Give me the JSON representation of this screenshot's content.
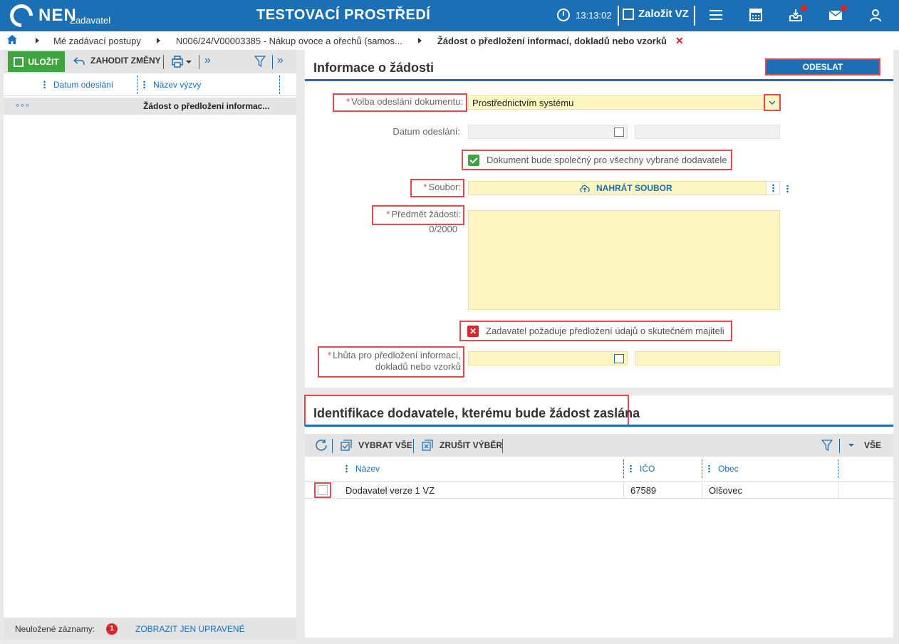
{
  "header": {
    "brand": "NEN",
    "brand_sub": "Zadavatel",
    "environment": "TESTOVACÍ PROSTŘEDÍ",
    "time": "13:13:02",
    "create_label": "Založit VZ",
    "icons": [
      "menu-icon",
      "calculator-icon",
      "inbox-icon",
      "mail-icon",
      "user-icon"
    ]
  },
  "breadcrumb": {
    "items": [
      "Mé zadávací postupy",
      "N006/24/V00003385 - Nákup ovoce a ořechů (samos...",
      "Žádost o předložení informací, dokladů nebo vzorků"
    ],
    "close": "✕"
  },
  "left_panel": {
    "save_label": "ULOŽIT",
    "discard_label": "ZAHODIT ZMĚNY",
    "columns": [
      "Datum odeslání",
      "Název výzvy"
    ],
    "rows": [
      {
        "menu": "∘∘∘",
        "date": "",
        "name": "Žádost o předložení informac..."
      }
    ],
    "footer_label": "Neuložené záznamy:",
    "footer_count": "1",
    "footer_link": "ZOBRAZIT JEN UPRAVENÉ"
  },
  "info_card": {
    "title": "Informace o žádosti",
    "send_label": "ODESLAT",
    "fields": {
      "volba_label": "Volba odeslání dokumentu:",
      "volba_value": "Prostřednictvím systému",
      "datum_label": "Datum odeslání:",
      "common_doc_label": "Dokument bude společný pro všechny vybrané dodavatele",
      "soubor_label": "Soubor:",
      "upload_label": "NAHRÁT SOUBOR",
      "predmet_label": "Předmět žádosti:",
      "predmet_counter": "0/2000",
      "majitel_label": "Zadavatel požaduje předložení údajů o skutečném majiteli",
      "lhuta_label_1": "Lhůta pro předložení informací,",
      "lhuta_label_2": "dokladů nebo vzorků"
    },
    "required_mark": "*"
  },
  "supplier_card": {
    "title": "Identifikace dodavatele, kterému bude žádost zaslána",
    "select_all": "VYBRAT VŠE",
    "clear_selection": "ZRUŠIT VÝBĚR",
    "filter_all": "VŠE",
    "columns": [
      "Název",
      "IČO",
      "Obec"
    ],
    "rows": [
      {
        "nazev": "Dodavatel verze 1 VZ",
        "ico": "67589",
        "obec": "Olšovec"
      }
    ]
  },
  "colors": {
    "primary": "#1a6fb5",
    "save_green": "#3fa33f",
    "required_red": "#e2484f",
    "input_yellow": "#fdf6c0"
  }
}
